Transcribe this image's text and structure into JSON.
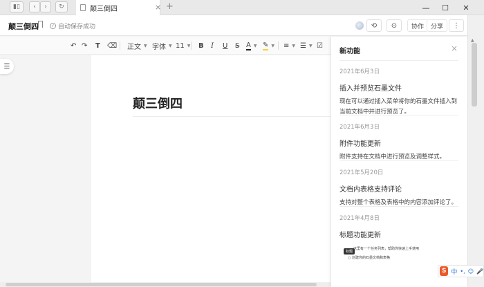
{
  "tab": {
    "title": "颠三倒四",
    "close_glyph": "×",
    "new_tab_glyph": "+"
  },
  "window_controls": {
    "minimize": "—",
    "maximize": "☐",
    "close": "✕"
  },
  "header": {
    "doc_title": "颠三倒四",
    "save_status": "自动保存成功",
    "collaborate_label": "协作",
    "share_label": "分享",
    "more_glyph": "⋮"
  },
  "toolbar": {
    "undo": "↶",
    "redo": "↷",
    "format_painter": "T",
    "clear_format": "⌫",
    "paragraph_style": "正文",
    "font_family": "字体",
    "font_size": "11",
    "bold": "B",
    "italic": "I",
    "underline": "U",
    "strikethrough": "S",
    "text_color": "A",
    "highlight": "✎",
    "ordered_list": "≡",
    "bullet_list": "☰",
    "checklist": "☑"
  },
  "page": {
    "heading": "颠三倒四"
  },
  "panel": {
    "title": "新功能",
    "close_glyph": "×",
    "entries": [
      {
        "date": "2021年6月3日",
        "title": "插入并预览石墨文件",
        "desc": "现在可以通过插入菜单将你的石墨文件插入到当前文档中并进行预览了。"
      },
      {
        "date": "2021年6月3日",
        "title": "附件功能更新",
        "desc": "附件支持在文档中进行预览及调整样式。"
      },
      {
        "date": "2021年5月20日",
        "title": "文档内表格支持评论",
        "desc": "支持对整个表格及表格中的内容添加评论了。"
      },
      {
        "date": "2021年4月8日",
        "title": "标题功能更新",
        "desc": ""
      }
    ],
    "preview": {
      "tag": "标题",
      "line1": "这里有一个任务列表，帮助你快速上手使用",
      "line2": "○ 创建你的石墨文档和表格"
    }
  },
  "ime": {
    "logo": "S",
    "lang": "中",
    "punct": "•,",
    "emoji": "☺",
    "mic": "🎤"
  },
  "colors": {
    "accent_ime": "#ea5a2a",
    "ime_blue": "#1d6fd8"
  }
}
